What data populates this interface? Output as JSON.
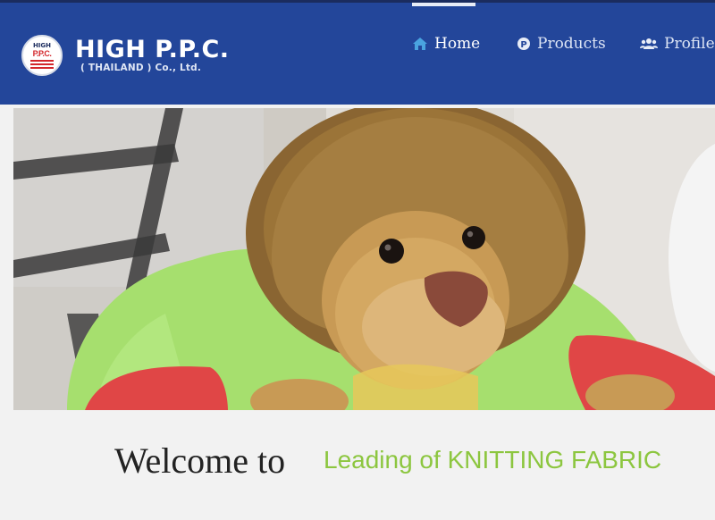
{
  "brand": {
    "badge_top": "HIGH",
    "badge_mid": "P.P.C.",
    "title": "HIGH P.P.C.",
    "subtitle": "( THAILAND ) Co., Ltd."
  },
  "nav": {
    "items": [
      {
        "label": "Home",
        "icon": "home-icon",
        "active": true
      },
      {
        "label": "Products",
        "icon": "p-circle-icon",
        "active": false
      },
      {
        "label": "Profile",
        "icon": "users-icon",
        "active": false
      }
    ]
  },
  "hero": {
    "image": "plush-lion-toy-on-green-and-red-cushion"
  },
  "welcome": {
    "heading": "Welcome to",
    "tagline": "Leading of KNITTING FABRIC"
  },
  "colors": {
    "navbar": "#23469a",
    "accent_green": "#8cc63f",
    "brand_red": "#d3262b"
  }
}
